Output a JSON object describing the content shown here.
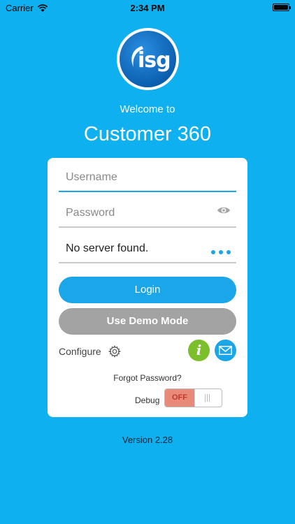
{
  "status_bar": {
    "carrier": "Carrier",
    "time": "2:34 PM",
    "icons": [
      "wifi-icon",
      "battery-icon"
    ]
  },
  "logo": {
    "text": "isg"
  },
  "header": {
    "welcome": "Welcome to",
    "title": "Customer 360"
  },
  "form": {
    "username_placeholder": "Username",
    "password_placeholder": "Password",
    "server_text": "No server found.",
    "login_label": "Login",
    "demo_label": "Use Demo Mode",
    "configure_label": "Configure",
    "forgot_label": "Forgot Password?",
    "debug_label": "Debug",
    "debug_toggle": "OFF"
  },
  "footer": {
    "version": "Version 2.28"
  },
  "colors": {
    "background": "#0eb0ef",
    "accent": "#1aa6e8",
    "demo_button": "#a3a3a3",
    "info": "#7bbf2a",
    "toggle_off": "#e8897a"
  }
}
